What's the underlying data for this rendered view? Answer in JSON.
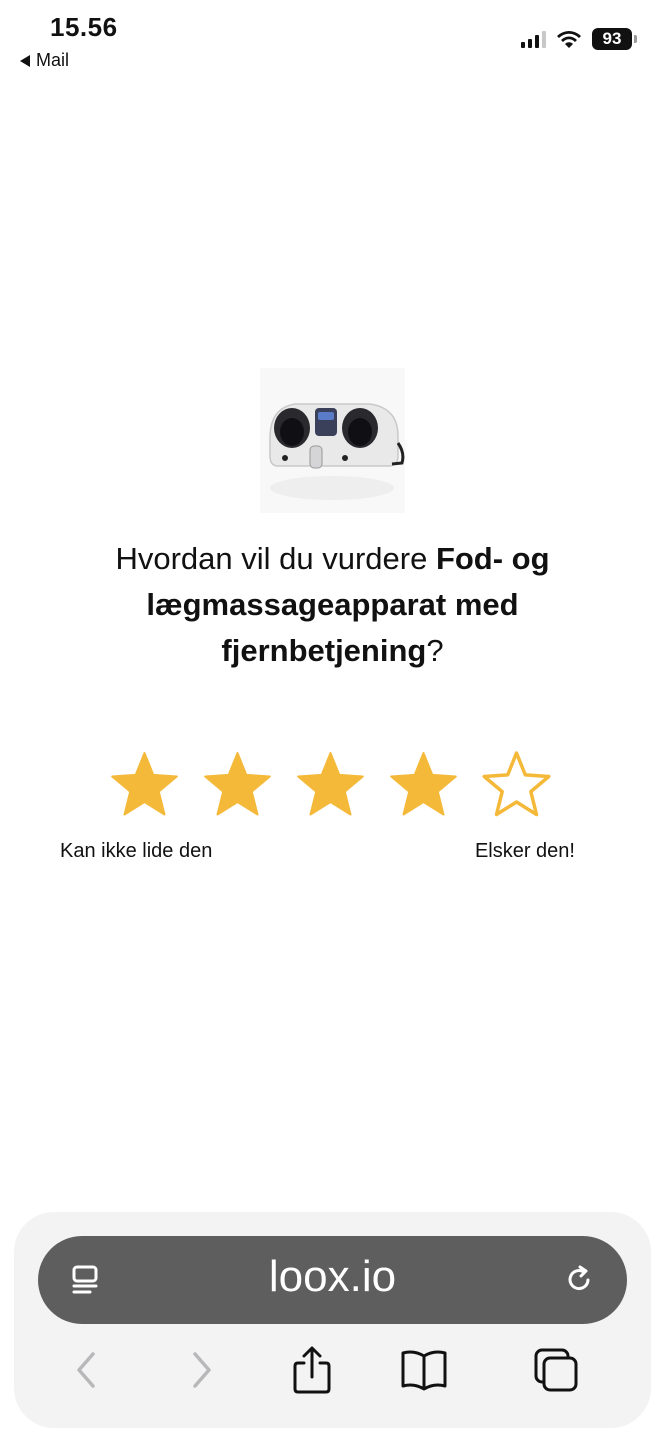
{
  "status_bar": {
    "time": "15.56",
    "back_label": "Mail",
    "battery": "93"
  },
  "product": {
    "image_icon": "foot-massager-image"
  },
  "question": {
    "prefix": "Hvordan vil du vurdere ",
    "product_name": "Fod- og lægmassageapparat med fjernbetjening",
    "suffix": "?"
  },
  "rating": {
    "selected": 4,
    "max": 5,
    "filled_color": "#F5B93A",
    "label_low": "Kan ikke lide den",
    "label_high": "Elsker den!"
  },
  "browser": {
    "url": "loox.io",
    "icons": [
      "reader-icon",
      "reload-icon",
      "back-icon",
      "forward-icon",
      "share-icon",
      "bookmarks-icon",
      "tabs-icon"
    ]
  }
}
